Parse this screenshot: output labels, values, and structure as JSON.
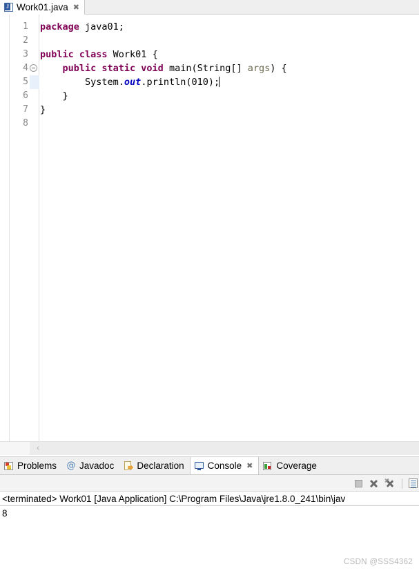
{
  "editor": {
    "tab": {
      "label": "Work01.java",
      "close_glyph": "✖",
      "icon": "java-file-icon",
      "icon_letter": "J"
    },
    "lines": [
      {
        "number": "1",
        "segments": [
          {
            "t": "package ",
            "c": "kw"
          },
          {
            "t": "java01;",
            "c": "plain"
          }
        ]
      },
      {
        "number": "2",
        "segments": []
      },
      {
        "number": "3",
        "segments": [
          {
            "t": "public class ",
            "c": "kw"
          },
          {
            "t": "Work01 {",
            "c": "plain"
          }
        ]
      },
      {
        "number": "4",
        "segments": [
          {
            "t": "    public static void ",
            "c": "kw"
          },
          {
            "t": "main(String[] ",
            "c": "plain"
          },
          {
            "t": "args",
            "c": "parm"
          },
          {
            "t": ") {",
            "c": "plain"
          }
        ]
      },
      {
        "number": "5",
        "segments": [
          {
            "t": "        System.",
            "c": "plain"
          },
          {
            "t": "out",
            "c": "fld"
          },
          {
            "t": ".println(010);",
            "c": "plain"
          }
        ]
      },
      {
        "number": "6",
        "segments": [
          {
            "t": "    }",
            "c": "plain"
          }
        ]
      },
      {
        "number": "7",
        "segments": [
          {
            "t": "}",
            "c": "plain"
          }
        ]
      },
      {
        "number": "8",
        "segments": []
      }
    ],
    "current_line_index": 4,
    "fold_marker_line_index": 3,
    "range_indicator": {
      "start_line_index": 3,
      "end_line_index": 5
    },
    "hscroll_arrow_glyph": "‹"
  },
  "console_part": {
    "tabs": [
      {
        "label": "Problems",
        "icon": "problems-icon",
        "active": false,
        "closable": false
      },
      {
        "label": "Javadoc",
        "icon": "javadoc-icon",
        "active": false,
        "closable": false
      },
      {
        "label": "Declaration",
        "icon": "declaration-icon",
        "active": false,
        "closable": false
      },
      {
        "label": "Console",
        "icon": "console-icon",
        "active": true,
        "closable": true
      },
      {
        "label": "Coverage",
        "icon": "coverage-icon",
        "active": false,
        "closable": false
      }
    ],
    "tab_close_glyph": "✖",
    "toolbar": [
      {
        "name": "terminate-button",
        "icon": "stop-square-icon"
      },
      {
        "name": "remove-launch-button",
        "icon": "remove-x-icon"
      },
      {
        "name": "remove-all-launches-button",
        "icon": "remove-all-x-icon"
      },
      {
        "name": "toolbar-separator",
        "icon": "separator"
      },
      {
        "name": "display-selected-console-button",
        "icon": "console-list-icon"
      }
    ],
    "header_text": "<terminated> Work01 [Java Application] C:\\Program Files\\Java\\jre1.8.0_241\\bin\\jav",
    "output_lines": [
      "8"
    ]
  },
  "watermark": {
    "text": "CSDN @SSS4362"
  },
  "colors": {
    "keyword": "#7f0055",
    "field": "#0000c0",
    "parameter": "#6a6a50",
    "current_line_highlight": "#e8f0fb",
    "range_indicator": "#5a9bd5",
    "chrome": "#efefef"
  }
}
